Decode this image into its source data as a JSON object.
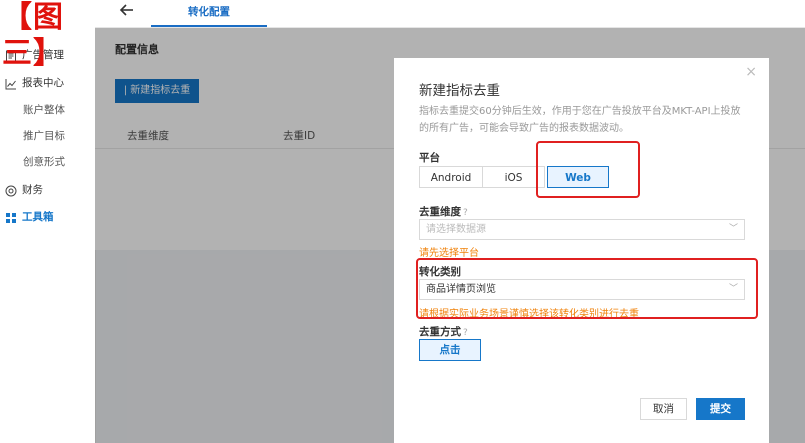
{
  "figure_label": "【图三】",
  "sidebar": {
    "items": [
      {
        "label": "广告管理",
        "icon": "document-icon"
      },
      {
        "label": "报表中心",
        "icon": "line-chart-icon"
      },
      {
        "label": "账户整体"
      },
      {
        "label": "推广目标"
      },
      {
        "label": "创意形式"
      },
      {
        "label": "财务",
        "icon": "coin-icon"
      },
      {
        "label": "工具箱",
        "icon": "grid-icon"
      }
    ]
  },
  "topbar": {
    "back_icon": "arrow-left-icon",
    "active_tab": "转化配置"
  },
  "main": {
    "section_title": "配置信息",
    "new_button": "| 新建指标去重",
    "columns": [
      "去重维度",
      "去重ID"
    ]
  },
  "modal": {
    "title": "新建指标去重",
    "description": "指标去重提交60分钟后生效，作用于您在广告投放平台及MKT-API上投放的所有广告，可能会导致广告的报表数据波动。",
    "platform_label": "平台",
    "platforms": [
      "Android",
      "iOS",
      "Web"
    ],
    "selected_platform": "Web",
    "dimension_label": "去重维度",
    "dimension_placeholder": "请选择数据源",
    "dimension_error": "请先选择平台",
    "category_label": "转化类别",
    "category_value": "商品详情页浏览",
    "category_hint": "请根据实际业务场景谨慎选择该转化类别进行去重",
    "method_label": "去重方式",
    "method_value": "点击",
    "cancel_label": "取消",
    "submit_label": "提交"
  },
  "colors": {
    "accent": "#1677c9",
    "highlight": "#e02020",
    "warning": "#f0820a"
  }
}
